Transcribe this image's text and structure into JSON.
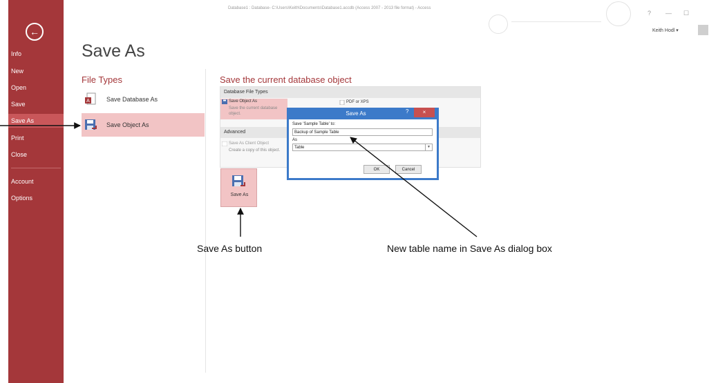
{
  "titlebar": {
    "title": "Database1 : Database- C:\\Users\\Keith\\Documents\\Database1.accdb (Access 2007 - 2013 file format) - Access",
    "help": "?",
    "minimize": "—",
    "restore": "☐",
    "account_name": "Keith Hodl ▾"
  },
  "sidebar": {
    "back_icon": "←",
    "items": [
      {
        "label": "Info"
      },
      {
        "label": "New"
      },
      {
        "label": "Open"
      },
      {
        "label": "Save"
      },
      {
        "label": "Save As"
      },
      {
        "label": "Print"
      },
      {
        "label": "Close"
      },
      {
        "label": "Account"
      },
      {
        "label": "Options"
      }
    ]
  },
  "main": {
    "page_title": "Save As",
    "file_types_header": "File Types",
    "file_types": [
      {
        "label": "Save Database As"
      },
      {
        "label": "Save Object As"
      }
    ],
    "right_header": "Save the current database object",
    "groups": {
      "database_file_types": "Database File Types",
      "advanced": "Advanced"
    },
    "options": {
      "save_object_as_title": "Save Object As",
      "save_object_as_desc": "Save the current database object.",
      "pdf_xps_title": "PDF or XPS",
      "save_as_client_title": "Save As Client Object",
      "save_as_client_desc": "Create a copy of this object."
    },
    "save_as_button": "Save As"
  },
  "dialog": {
    "title": "Save As",
    "help": "?",
    "close": "×",
    "save_label": "Save 'Sample Table' to:",
    "name_value": "Backup of Sample Table",
    "as_label": "As",
    "as_value": "Table",
    "ok": "OK",
    "cancel": "Cancel"
  },
  "callouts": {
    "save_as_button": "Save As button",
    "new_table_name": "New table name in Save As dialog box"
  },
  "colors": {
    "sidebar": "#a4373a",
    "selection": "#f2c4c5",
    "dialog_frame": "#3c7ac9"
  }
}
